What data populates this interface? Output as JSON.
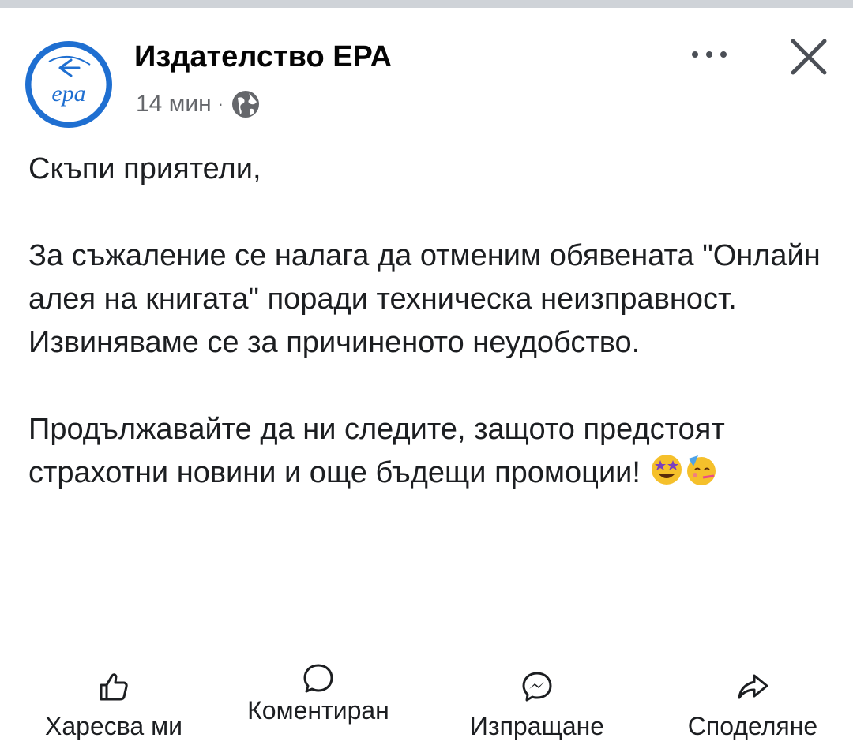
{
  "post": {
    "page_name": "Издателство ЕРА",
    "logo_text": "ера",
    "time": "14 мин",
    "separator": "·",
    "privacy_icon": "globe-icon",
    "paragraphs": [
      "Скъпи приятели,",
      "За съжаление се налага да отменим обявената \"Онлайн алея на книгата\" поради техническа неизправност. Извиняваме се за причиненото неудобство.",
      "Продължавайте да ни следите, защото предстоят страхотни новини и още бъдещи промоции!"
    ]
  },
  "header_actions": {
    "more_icon": "more-horizontal-icon",
    "close_icon": "close-icon"
  },
  "actions": {
    "like": {
      "label": "Харесва ми",
      "icon": "thumbs-up-icon"
    },
    "comment": {
      "label": "Коментиран",
      "icon": "comment-icon"
    },
    "send": {
      "label": "Изпращане",
      "icon": "messenger-icon"
    },
    "share": {
      "label": "Споделяне",
      "icon": "share-icon"
    }
  },
  "colors": {
    "brand_blue": "#1f6fd1",
    "muted_text": "#65676b",
    "top_bar": "#cfd3d8"
  }
}
